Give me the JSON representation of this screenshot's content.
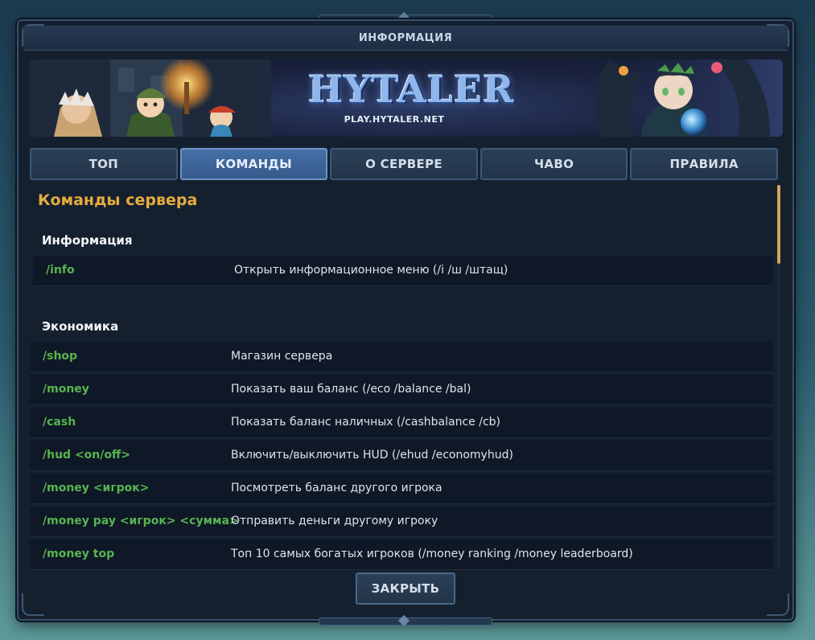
{
  "window": {
    "title": "ИНФОРМАЦИЯ"
  },
  "banner": {
    "logo": "HYTALER",
    "url": "PLAY.HYTALER.NET"
  },
  "tabs": [
    {
      "label": "ТОП",
      "active": false
    },
    {
      "label": "КОМАНДЫ",
      "active": true
    },
    {
      "label": "О СЕРВЕРЕ",
      "active": false
    },
    {
      "label": "ЧАВО",
      "active": false
    },
    {
      "label": "ПРАВИЛА",
      "active": false
    }
  ],
  "content": {
    "title": "Команды сервера",
    "sections": [
      {
        "title": "Информация",
        "rows": [
          {
            "cmd": "/info",
            "desc": "Открыть информационное меню (/i /ш /штащ)"
          }
        ]
      },
      {
        "title": "Экономика",
        "rows": [
          {
            "cmd": "/shop",
            "desc": "Магазин сервера"
          },
          {
            "cmd": "/money",
            "desc": "Показать ваш баланс (/eco /balance /bal)"
          },
          {
            "cmd": "/cash",
            "desc": "Показать баланс наличных (/cashbalance /cb)"
          },
          {
            "cmd": "/hud <on/off>",
            "desc": "Включить/выключить HUD (/ehud /economyhud)"
          },
          {
            "cmd": "/money <игрок>",
            "desc": "Посмотреть баланс другого игрока"
          },
          {
            "cmd": "/money pay <игрок> <сумма>",
            "desc": "Отправить деньги другому игроку"
          },
          {
            "cmd": "/money top",
            "desc": "Топ 10 самых богатых игроков (/money ranking /money leaderboard)"
          }
        ]
      }
    ]
  },
  "buttons": {
    "close": "ЗАКРЫТЬ"
  },
  "colors": {
    "accent_title": "#e5ad3e",
    "command": "#57b450",
    "active_tab": "#4670a8"
  }
}
